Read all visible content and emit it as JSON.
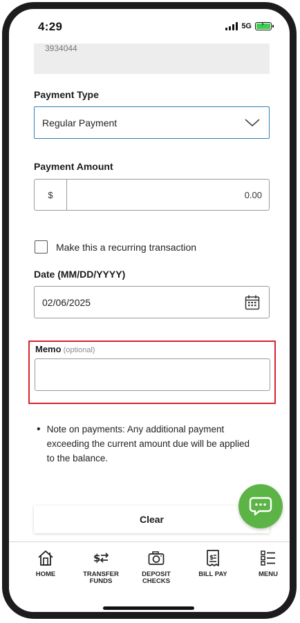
{
  "status_bar": {
    "time": "4:29",
    "network": "5G"
  },
  "previous_field": {
    "value": "3934044"
  },
  "payment_type": {
    "label": "Payment Type",
    "selected": "Regular Payment"
  },
  "payment_amount": {
    "label": "Payment Amount",
    "prefix": "$",
    "value": "0.00"
  },
  "recurring": {
    "label": "Make this a recurring transaction",
    "checked": false
  },
  "date": {
    "label": "Date (MM/DD/YYYY)",
    "value": "02/06/2025"
  },
  "memo": {
    "label": "Memo",
    "optional": "(optional)",
    "value": ""
  },
  "note": {
    "text": "Note on payments: Any additional payment exceeding the current amount due will be applied to the balance."
  },
  "actions": {
    "clear_label": "Clear"
  },
  "bottom_nav": {
    "items": [
      {
        "label": "HOME",
        "icon": "home-icon"
      },
      {
        "label": "TRANSFER\nFUNDS",
        "icon": "transfer-icon"
      },
      {
        "label": "DEPOSIT\nCHECKS",
        "icon": "camera-icon"
      },
      {
        "label": "BILL PAY",
        "icon": "bill-icon"
      },
      {
        "label": "MENU",
        "icon": "menu-list-icon"
      }
    ]
  },
  "colors": {
    "accent_border": "#2f7fb8",
    "highlight": "#d9232e",
    "chat_fab": "#5cb447",
    "battery": "#3ccf4e"
  }
}
